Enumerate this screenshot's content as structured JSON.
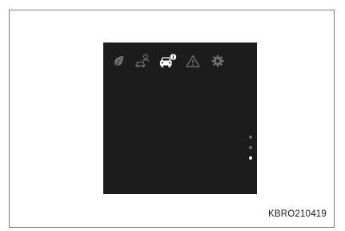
{
  "display": {
    "icons": [
      {
        "name": "eco-leaf-icon",
        "color": "#6e6e6e",
        "active": false
      },
      {
        "name": "driver-assist-icon",
        "color": "#6e6e6e",
        "active": false
      },
      {
        "name": "vehicle-info-icon",
        "color": "#ffffff",
        "active": true
      },
      {
        "name": "warning-icon",
        "color": "#6e6e6e",
        "active": false
      },
      {
        "name": "settings-gear-icon",
        "color": "#6e6e6e",
        "active": false
      }
    ],
    "page_indicator": {
      "total": 3,
      "active_index": 3,
      "active_color": "#ffffff",
      "inactive_color": "#6e6e6e"
    },
    "background": "#1c1c1c"
  },
  "caption": {
    "code": "KBRO210419"
  }
}
